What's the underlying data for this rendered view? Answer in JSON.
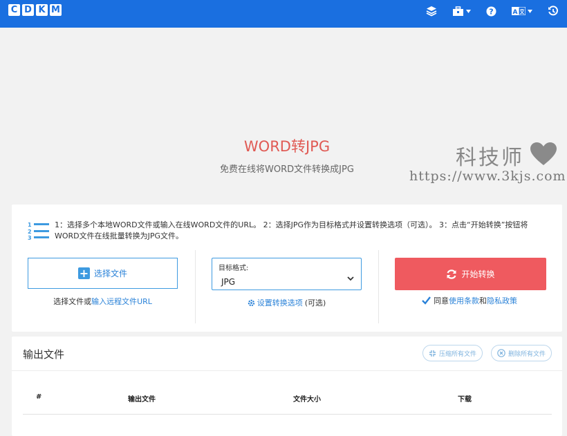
{
  "logo": {
    "letters": [
      "C",
      "D",
      "K",
      "M"
    ]
  },
  "nav": {
    "icons": [
      "layers-icon",
      "toolbox-icon",
      "help-icon",
      "language-icon",
      "history-icon"
    ]
  },
  "hero": {
    "title": "WORD转JPG",
    "subtitle": "免费在线将WORD文件转换成JPG"
  },
  "watermark": {
    "cn": "科技师",
    "url": "https://www.3kjs.com"
  },
  "steps": {
    "text": "1：选择多个本地WORD文件或输入在线WORD文件的URL。 2：选择JPG作为目标格式并设置转换选项（可选）。 3：点击“开始转换”按钮将WORD文件在线批量转换为JPG文件。"
  },
  "select": {
    "button_label": "选择文件",
    "help_prefix": "选择文件或",
    "help_link": "输入远程文件URL"
  },
  "format": {
    "label": "目标格式:",
    "value": "JPG",
    "settings_link": "设置转换选项",
    "settings_suffix": "(可选)"
  },
  "start": {
    "button_label": "开始转换",
    "agree_prefix": "同意",
    "terms": "使用条款",
    "and": "和",
    "privacy": "隐私政策"
  },
  "output": {
    "title": "输出文件",
    "compress_label": "压缩所有文件",
    "delete_label": "删除所有文件",
    "columns": [
      "#",
      "输出文件",
      "文件大小",
      "下载"
    ]
  },
  "colors": {
    "primary": "#1a6fe0",
    "accent": "#ef5a5f",
    "link": "#2a82d8",
    "title": "#e05a54"
  }
}
